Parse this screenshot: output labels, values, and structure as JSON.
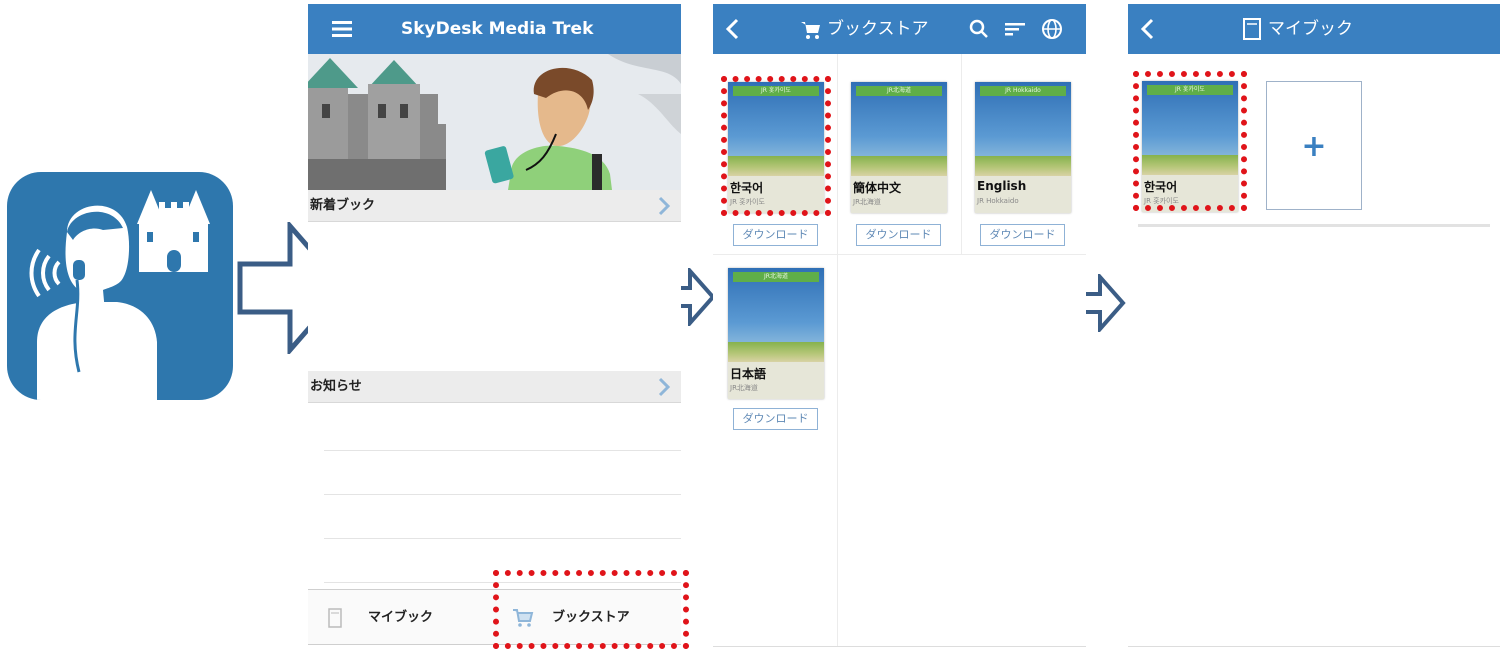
{
  "colors": {
    "navbar": "#3a80c1",
    "app_icon": "#2e77ad",
    "highlight": "#e0141a",
    "flow_arrow": "#3b5d86"
  },
  "app": {
    "icon_name": "audio-guide-castle-app-icon"
  },
  "screen_home": {
    "title": "SkyDesk Media Trek",
    "menu_icon": "hamburger-menu-icon",
    "new_books_label": "新着ブック",
    "notices_label": "お知らせ",
    "tabs": [
      {
        "label": "マイブック",
        "icon": "book-icon"
      },
      {
        "label": "ブックストア",
        "icon": "cart-icon"
      }
    ]
  },
  "screen_store": {
    "title": "ブックストア",
    "icons": [
      "back-icon",
      "cart-icon",
      "search-icon",
      "sort-icon",
      "globe-icon"
    ],
    "books": [
      {
        "title": "한국어",
        "subtitle": "JR 홋카이도",
        "strip": "JR 홋카이도",
        "button": "ダウンロード"
      },
      {
        "title": "簡体中文",
        "subtitle": "JR北海道",
        "strip": "JR北海道",
        "button": "ダウンロード"
      },
      {
        "title": "English",
        "subtitle": "JR Hokkaido",
        "strip": "JR Hokkaido",
        "button": "ダウンロード"
      },
      {
        "title": "日本語",
        "subtitle": "JR北海道",
        "strip": "JR北海道",
        "button": "ダウンロード"
      }
    ]
  },
  "screen_mybook": {
    "title": "マイブック",
    "book": {
      "title": "한국어",
      "subtitle": "JR 홋카이도",
      "strip": "JR 홋카이도"
    },
    "add_label": "+"
  }
}
